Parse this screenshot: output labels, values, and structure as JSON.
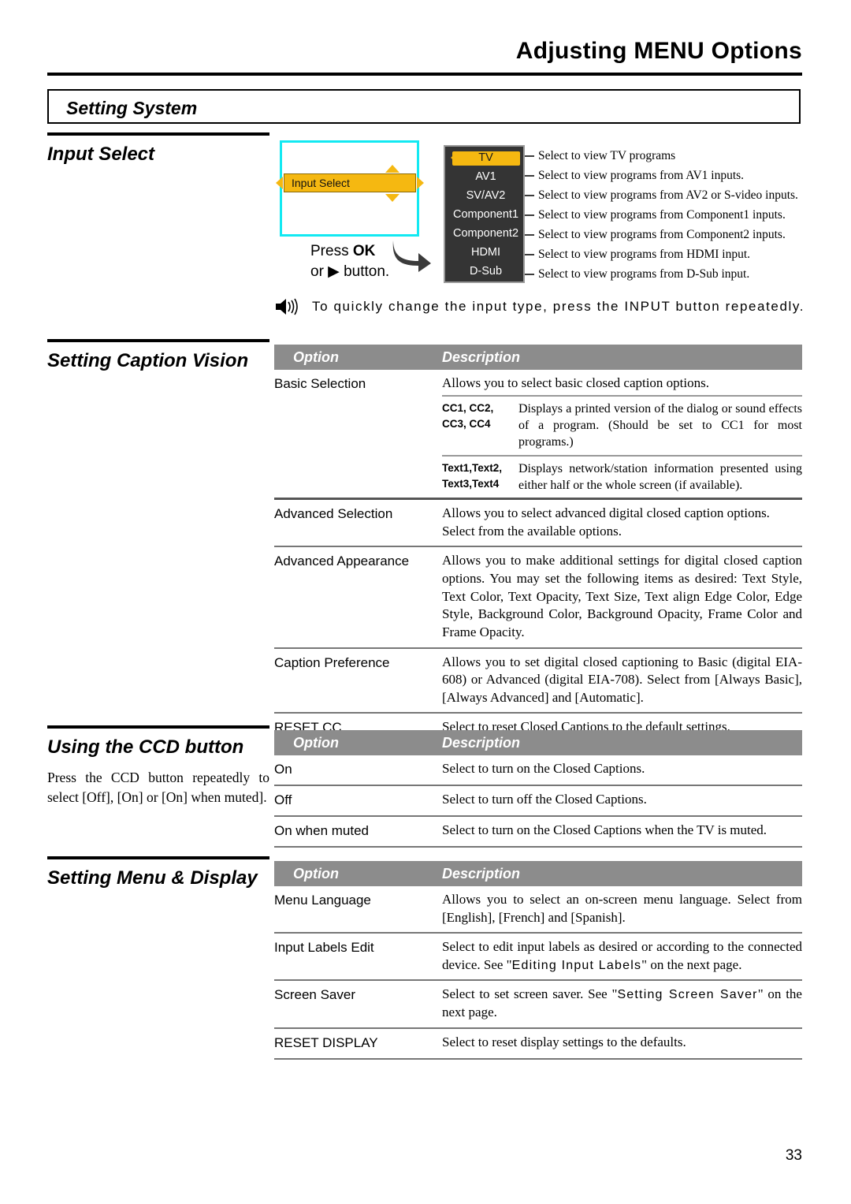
{
  "header": {
    "title": "Adjusting MENU Options",
    "banner": "Setting System"
  },
  "page_number": "33",
  "input_select": {
    "section_title": "Input Select",
    "osd": {
      "menu_item": "Input Select",
      "press_line1_pre": "Press ",
      "press_line1_bold": "OK",
      "press_line2": "or ▶ button."
    },
    "inputs": [
      {
        "label": "TV",
        "selected": true,
        "description": "Select to view TV programs"
      },
      {
        "label": "AV1",
        "selected": false,
        "description": "Select to view programs from AV1 inputs."
      },
      {
        "label": "SV/AV2",
        "selected": false,
        "description": "Select to view programs from AV2 or S-video inputs."
      },
      {
        "label": "Component1",
        "selected": false,
        "description": "Select to view programs from Component1 inputs."
      },
      {
        "label": "Component2",
        "selected": false,
        "description": "Select to view programs from Component2 inputs."
      },
      {
        "label": "HDMI",
        "selected": false,
        "description": "Select to view programs from HDMI input."
      },
      {
        "label": "D-Sub",
        "selected": false,
        "description": "Select to view programs from D-Sub input."
      }
    ],
    "note": "To quickly change the input type, press the INPUT button repeatedly."
  },
  "caption_vision": {
    "section_title": "Setting Caption Vision",
    "columns": {
      "option": "Option",
      "description": "Description"
    },
    "rows": [
      {
        "option": "Basic Selection",
        "description": "Allows you to select basic closed caption options.",
        "subrows": [
          {
            "label_line1": "CC1, CC2,",
            "label_line2": "CC3, CC4",
            "text": "Displays a printed version of the dialog or sound effects of a program. (Should be set to CC1 for most programs.)"
          },
          {
            "label_line1": "Text1,Text2,",
            "label_line2": "Text3,Text4",
            "text": "Displays network/station information presented using either half or the whole screen (if available)."
          }
        ]
      },
      {
        "option": "Advanced Selection",
        "description": "Allows you to select advanced digital closed caption options. Select from the available options."
      },
      {
        "option": "Advanced Appearance",
        "description": "Allows you to make additional settings for digital closed caption options. You may set the following items as desired: Text Style, Text Color, Text Opacity, Text Size, Text align Edge Color, Edge Style, Background Color, Background Opacity, Frame Color and Frame Opacity."
      },
      {
        "option": "Caption Preference",
        "description": "Allows you to set digital closed captioning to Basic (digital EIA-608) or Advanced (digital EIA-708). Select from [Always Basic], [Always Advanced] and [Automatic]."
      },
      {
        "option": "RESET CC",
        "description": "Select to reset Closed Captions to the default settings."
      }
    ]
  },
  "ccd_button": {
    "section_title": "Using the CCD button",
    "body": "Press the CCD button repeatedly to select [Off], [On] or [On] when muted].",
    "columns": {
      "option": "Option",
      "description": "Description"
    },
    "rows": [
      {
        "option": "On",
        "description": "Select to turn on the Closed Captions."
      },
      {
        "option": "Off",
        "description": "Select to turn off the Closed Captions."
      },
      {
        "option": "On when muted",
        "description": "Select to turn on the Closed Captions when the TV is muted."
      }
    ]
  },
  "menu_display": {
    "section_title": "Setting Menu & Display",
    "columns": {
      "option": "Option",
      "description": "Description"
    },
    "rows": [
      {
        "option": "Menu Language",
        "description": "Allows you to select an on-screen menu language. Select from [English], [French] and [Spanish]."
      },
      {
        "option": "Input Labels Edit",
        "desc_part1": "Select to edit input labels as desired or according to the connected device. See \"",
        "desc_ref": "Editing Input Labels",
        "desc_part2": "\" on the next page."
      },
      {
        "option": "Screen Saver",
        "desc_part1": "Select to set screen saver. See \"",
        "desc_ref": "Setting Screen Saver",
        "desc_part2": "\" on the next page."
      },
      {
        "option": "RESET DISPLAY",
        "description": "Select to reset display settings to the defaults."
      }
    ]
  },
  "colors": {
    "osd_border": "#12e9f2",
    "osd_highlight": "#f5b811",
    "osd_panel": "#343434",
    "table_header": "#8c8c8c"
  }
}
